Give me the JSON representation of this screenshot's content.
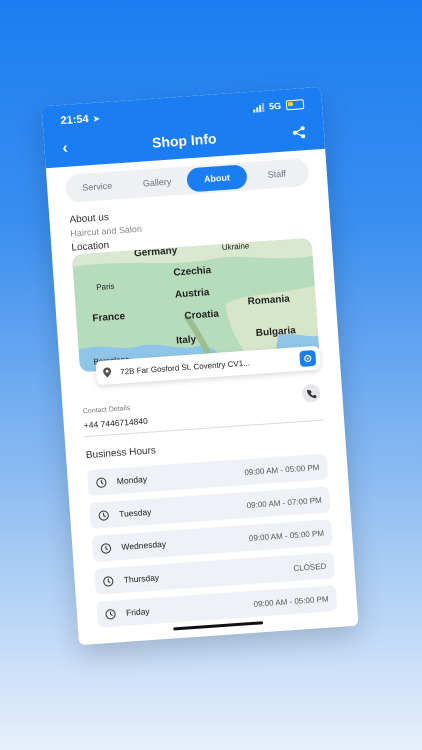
{
  "status": {
    "time": "21:54",
    "network": "5G"
  },
  "header": {
    "title": "Shop Info"
  },
  "tabs": [
    {
      "label": "Service",
      "active": false
    },
    {
      "label": "Gallery",
      "active": false
    },
    {
      "label": "About",
      "active": true
    },
    {
      "label": "Staff",
      "active": false
    }
  ],
  "about": {
    "heading": "About us",
    "text": "Haircut and Salon"
  },
  "location": {
    "heading": "Location",
    "map_labels": [
      "Germany",
      "Czechia",
      "Paris",
      "Austria",
      "France",
      "Croatia",
      "Romania",
      "Italy",
      "Bulgaria",
      "Barcelona",
      "Ukraine"
    ],
    "address": "72B Far Gosford St, Coventry CV1..."
  },
  "contact": {
    "label": "Contact Details",
    "phone": "+44 7446714840"
  },
  "business_hours": {
    "heading": "Business Hours",
    "rows": [
      {
        "day": "Monday",
        "time": "09:00 AM - 05:00 PM"
      },
      {
        "day": "Tuesday",
        "time": "09:00 AM - 07:00 PM"
      },
      {
        "day": "Wednesday",
        "time": "09:00 AM - 05:00 PM"
      },
      {
        "day": "Thursday",
        "time": "CLOSED"
      },
      {
        "day": "Friday",
        "time": "09:00 AM - 05:00 PM"
      }
    ]
  },
  "colors": {
    "accent": "#1a7ef2",
    "battery": "#ffd21a",
    "row_bg": "#eef1f6"
  }
}
